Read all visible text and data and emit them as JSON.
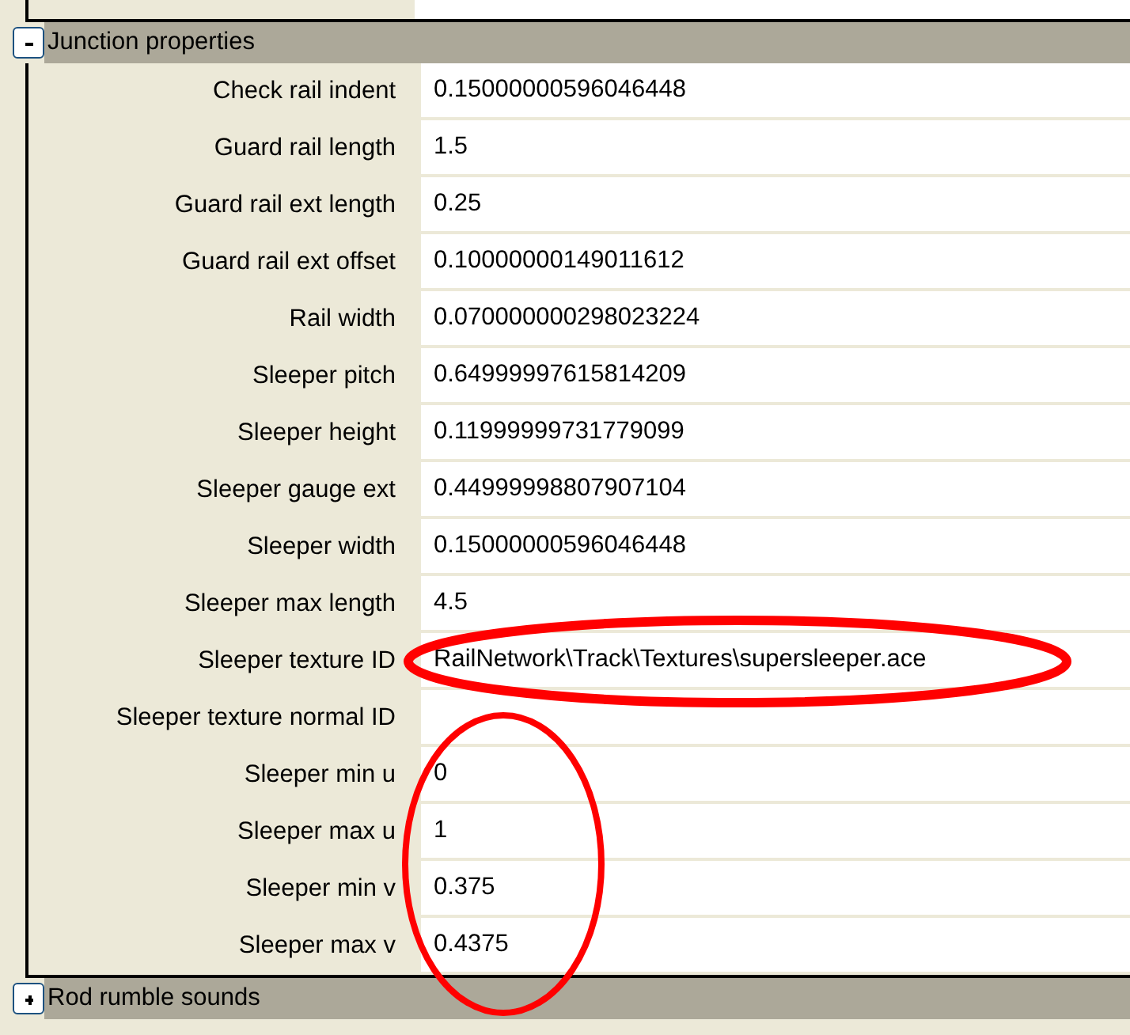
{
  "groups": [
    {
      "title": "Junction properties",
      "expanded": true,
      "properties": [
        {
          "label": "Check rail indent",
          "value": "0.15000000596046448"
        },
        {
          "label": "Guard rail length",
          "value": "1.5"
        },
        {
          "label": "Guard rail ext length",
          "value": "0.25"
        },
        {
          "label": "Guard rail ext offset",
          "value": "0.10000000149011612"
        },
        {
          "label": "Rail width",
          "value": "0.070000000298023224"
        },
        {
          "label": "Sleeper pitch",
          "value": "0.64999997615814209"
        },
        {
          "label": "Sleeper height",
          "value": "0.11999999731779099"
        },
        {
          "label": "Sleeper gauge ext",
          "value": "0.44999998807907104"
        },
        {
          "label": "Sleeper width",
          "value": "0.15000000596046448"
        },
        {
          "label": "Sleeper max length",
          "value": "4.5"
        },
        {
          "label": "Sleeper texture ID",
          "value": "RailNetwork\\Track\\Textures\\supersleeper.ace"
        },
        {
          "label": "Sleeper texture normal ID"
        },
        {
          "label": "Sleeper min u",
          "value": "0"
        },
        {
          "label": "Sleeper max u",
          "value": "1"
        },
        {
          "label": "Sleeper min v",
          "value": "0.375"
        },
        {
          "label": "Sleeper max v",
          "value": "0.4375"
        }
      ]
    },
    {
      "title": "Rod rumble sounds",
      "expanded": false
    }
  ]
}
